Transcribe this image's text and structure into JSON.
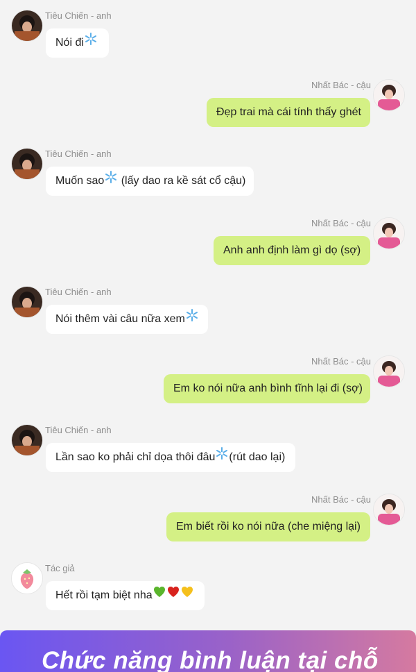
{
  "status_bar": {
    "left": "",
    "right": ""
  },
  "messages": [
    {
      "side": "left",
      "sender": "Tiêu Chiến - anh",
      "avatar": "guy-black-hair-avatar",
      "text": "Nói đi",
      "suffix": [],
      "emoji": [
        "snowflake"
      ]
    },
    {
      "side": "right",
      "sender": "Nhất Bác - cậu",
      "avatar": "guy-pink-outfit-avatar",
      "text": "Đẹp trai mà cái tính thấy ghét",
      "emoji": []
    },
    {
      "side": "left",
      "sender": "Tiêu Chiến - anh",
      "avatar": "guy-black-hair-avatar",
      "text": "Muốn sao",
      "emoji": [
        "snowflake"
      ],
      "after": " (lấy dao ra kề sát cổ cậu)"
    },
    {
      "side": "right",
      "sender": "Nhất Bác - cậu",
      "avatar": "guy-pink-outfit-avatar",
      "text": "Anh anh định làm gì dọ (sợ)",
      "emoji": []
    },
    {
      "side": "left",
      "sender": "Tiêu Chiến - anh",
      "avatar": "guy-black-hair-avatar",
      "text": "Nói thêm vài câu nữa xem",
      "emoji": [
        "snowflake"
      ]
    },
    {
      "side": "right",
      "sender": "Nhất Bác - cậu",
      "avatar": "guy-pink-outfit-avatar",
      "text": "Em ko nói nữa anh bình tĩnh lại đi (sợ)",
      "emoji": []
    },
    {
      "side": "left",
      "sender": "Tiêu Chiến - anh",
      "avatar": "guy-black-hair-avatar",
      "text": "Lần sao ko phải chỉ dọa thôi đâu",
      "emoji": [
        "snowflake"
      ],
      "after": "(rút dao lại)"
    },
    {
      "side": "right",
      "sender": "Nhất Bác - cậu",
      "avatar": "guy-pink-outfit-avatar",
      "text": "Em biết rồi ko nói nữa (che miệng lại)",
      "emoji": []
    },
    {
      "side": "left",
      "sender": "Tác giả",
      "avatar": "strawberry-avatar",
      "text": "Hết rồi tạm biệt nha",
      "emoji": [
        "green-heart",
        "red-heart",
        "yellow-heart"
      ]
    }
  ],
  "promo_banner": {
    "text": "Chức năng bình luận tại chỗ"
  },
  "colors": {
    "background": "#f3f3f3",
    "outgoing_bubble": "#d4f085",
    "incoming_bubble": "#ffffff",
    "sender_name": "#8e8e8e"
  }
}
